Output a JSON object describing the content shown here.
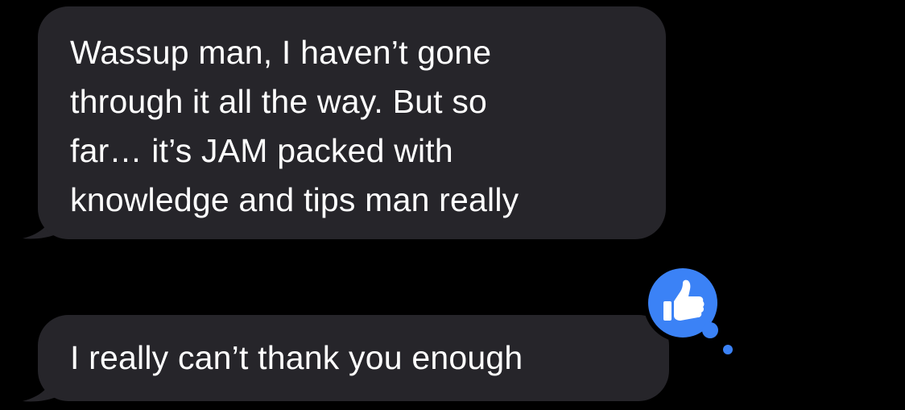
{
  "messages": [
    {
      "lines": [
        "Wassup man, I haven’t gone",
        "through it all the way. But so",
        "far… it’s JAM packed with",
        "knowledge and tips man really"
      ]
    },
    {
      "lines": [
        "I really can’t thank you enough"
      ]
    }
  ],
  "tapback": {
    "icon": "thumbs-up-icon",
    "color": "#3b82f6"
  },
  "colors": {
    "background": "#000000",
    "bubble": "#26252a",
    "text": "#ffffff",
    "tapback": "#3b82f6"
  }
}
